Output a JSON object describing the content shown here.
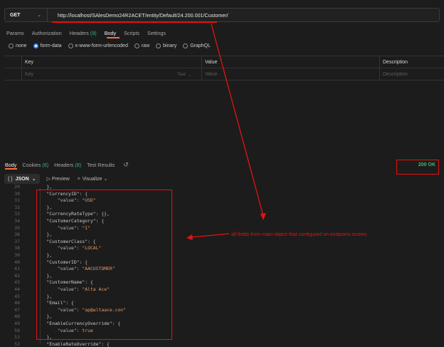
{
  "request": {
    "method": "GET",
    "url": "http://localhost/SAlesDemo24R2ACET/entity/Default/24.200.001/Customer/"
  },
  "request_tabs": [
    {
      "label": "Params",
      "count": ""
    },
    {
      "label": "Authorization",
      "count": ""
    },
    {
      "label": "Headers",
      "count": "(9)"
    },
    {
      "label": "Body",
      "count": ""
    },
    {
      "label": "Scripts",
      "count": ""
    },
    {
      "label": "Settings",
      "count": ""
    }
  ],
  "body_options": [
    "none",
    "form-data",
    "x-www-form-urlencoded",
    "raw",
    "binary",
    "GraphQL"
  ],
  "body_option_selected": "form-data",
  "kv_table": {
    "headers": [
      "Key",
      "Value",
      "Description"
    ],
    "placeholders": [
      "Key",
      "Value",
      "Description"
    ],
    "type_select": "Text"
  },
  "response_tabs": [
    {
      "label": "Body",
      "count": ""
    },
    {
      "label": "Cookies",
      "count": "(6)"
    },
    {
      "label": "Headers",
      "count": "(8)"
    },
    {
      "label": "Test Results",
      "count": ""
    }
  ],
  "status": "200 OK",
  "view": {
    "format": "JSON",
    "preview": "Preview",
    "visualize": "Visualize"
  },
  "code_lines": [
    {
      "n": "29",
      "text": "    },"
    },
    {
      "n": "30",
      "text": "    \"CurrencyID\": {"
    },
    {
      "n": "31",
      "text": "        \"value\": \"USD\""
    },
    {
      "n": "32",
      "text": "    },"
    },
    {
      "n": "33",
      "text": "    \"CurrencyRateType\": {},"
    },
    {
      "n": "34",
      "text": "    \"CustomerCategory\": {"
    },
    {
      "n": "35",
      "text": "        \"value\": \"I\""
    },
    {
      "n": "36",
      "text": "    },"
    },
    {
      "n": "37",
      "text": "    \"CustomerClass\": {"
    },
    {
      "n": "38",
      "text": "        \"value\": \"LOCAL\""
    },
    {
      "n": "39",
      "text": "    },"
    },
    {
      "n": "40",
      "text": "    \"CustomerID\": {"
    },
    {
      "n": "41",
      "text": "        \"value\": \"AACUSTOMER\""
    },
    {
      "n": "42",
      "text": "    },"
    },
    {
      "n": "43",
      "text": "    \"CustomerName\": {"
    },
    {
      "n": "44",
      "text": "        \"value\": \"Alta Ace\""
    },
    {
      "n": "45",
      "text": "    },"
    },
    {
      "n": "46",
      "text": "    \"Email\": {"
    },
    {
      "n": "47",
      "text": "        \"value\": \"ap@altaace.con\""
    },
    {
      "n": "48",
      "text": "    },"
    },
    {
      "n": "49",
      "text": "    \"EnableCurrencyOverride\": {"
    },
    {
      "n": "50",
      "text": "        \"value\": true"
    },
    {
      "n": "51",
      "text": "    },"
    },
    {
      "n": "52",
      "text": "    \"EnableRateOverride\": {"
    }
  ],
  "annotation": "all fields from main object that configured on endpoins screen",
  "colors": {
    "accent": "#ff6c37",
    "annotation_red": "#e51212",
    "status_green": "#2fbf71",
    "radio_blue": "#3b8cff"
  }
}
